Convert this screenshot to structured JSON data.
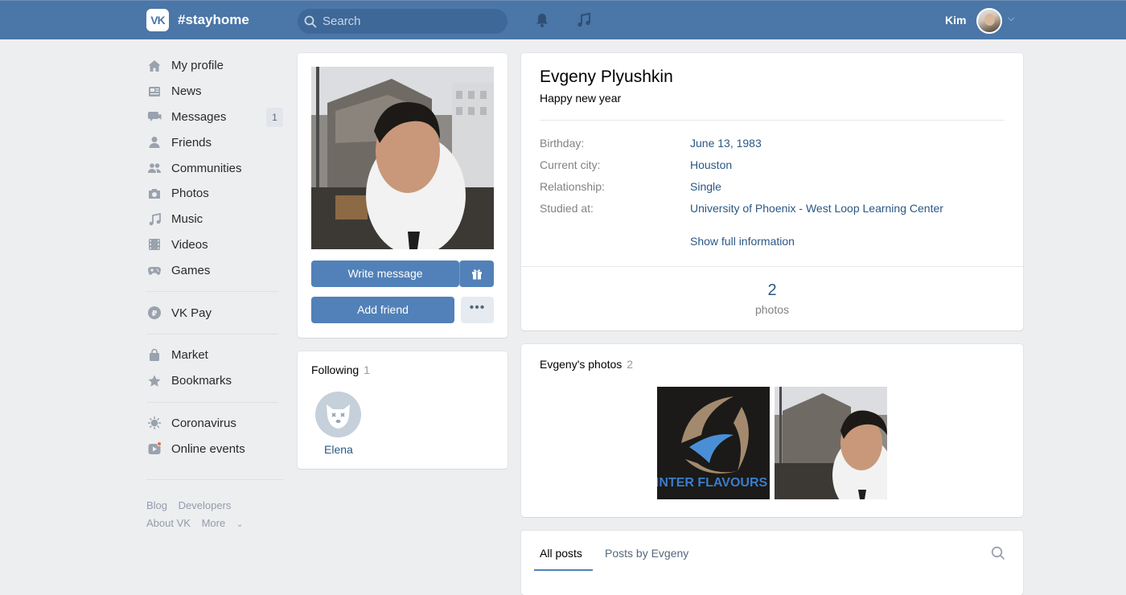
{
  "header": {
    "logo_text": "VK",
    "brand": "#stayhome",
    "search_placeholder": "Search",
    "user_name": "Kim"
  },
  "nav": {
    "items": [
      {
        "label": "My profile",
        "icon": "home-icon"
      },
      {
        "label": "News",
        "icon": "news-icon"
      },
      {
        "label": "Messages",
        "icon": "messages-icon",
        "badge": "1"
      },
      {
        "label": "Friends",
        "icon": "friends-icon"
      },
      {
        "label": "Communities",
        "icon": "communities-icon"
      },
      {
        "label": "Photos",
        "icon": "camera-icon"
      },
      {
        "label": "Music",
        "icon": "music-icon"
      },
      {
        "label": "Videos",
        "icon": "videos-icon"
      },
      {
        "label": "Games",
        "icon": "gamepad-icon"
      },
      {
        "label": "VK Pay",
        "icon": "vkpay-icon"
      },
      {
        "label": "Market",
        "icon": "market-icon"
      },
      {
        "label": "Bookmarks",
        "icon": "star-icon"
      },
      {
        "label": "Coronavirus",
        "icon": "virus-icon"
      },
      {
        "label": "Online events",
        "icon": "online-events-icon"
      }
    ],
    "footer": [
      "Blog",
      "Developers",
      "About VK",
      "More"
    ]
  },
  "profile_card": {
    "write_message": "Write message",
    "add_friend": "Add friend",
    "more": "•••"
  },
  "following": {
    "title": "Following",
    "count": "1",
    "friend_name": "Elena"
  },
  "profile": {
    "name": "Evgeny Plyushkin",
    "status": "Happy new year",
    "info": [
      {
        "label": "Birthday:",
        "value": "June 13, 1983"
      },
      {
        "label": "Current city:",
        "value": "Houston"
      },
      {
        "label": "Relationship:",
        "value": "Single"
      },
      {
        "label": "Studied at:",
        "value": "University of Phoenix - West Loop Learning Center"
      }
    ],
    "show_full": "Show full information",
    "counter_value": "2",
    "counter_label": "photos"
  },
  "photos": {
    "title": "Evgeny's photos",
    "count": "2",
    "thumb1_text": "WINTER FLAVOURS"
  },
  "posts": {
    "tabs": [
      "All posts",
      "Posts by Evgeny"
    ]
  },
  "colors": {
    "header_bg": "#4a76a8",
    "accent": "#5181b8",
    "link": "#2a5885",
    "page_bg": "#edeef0"
  }
}
